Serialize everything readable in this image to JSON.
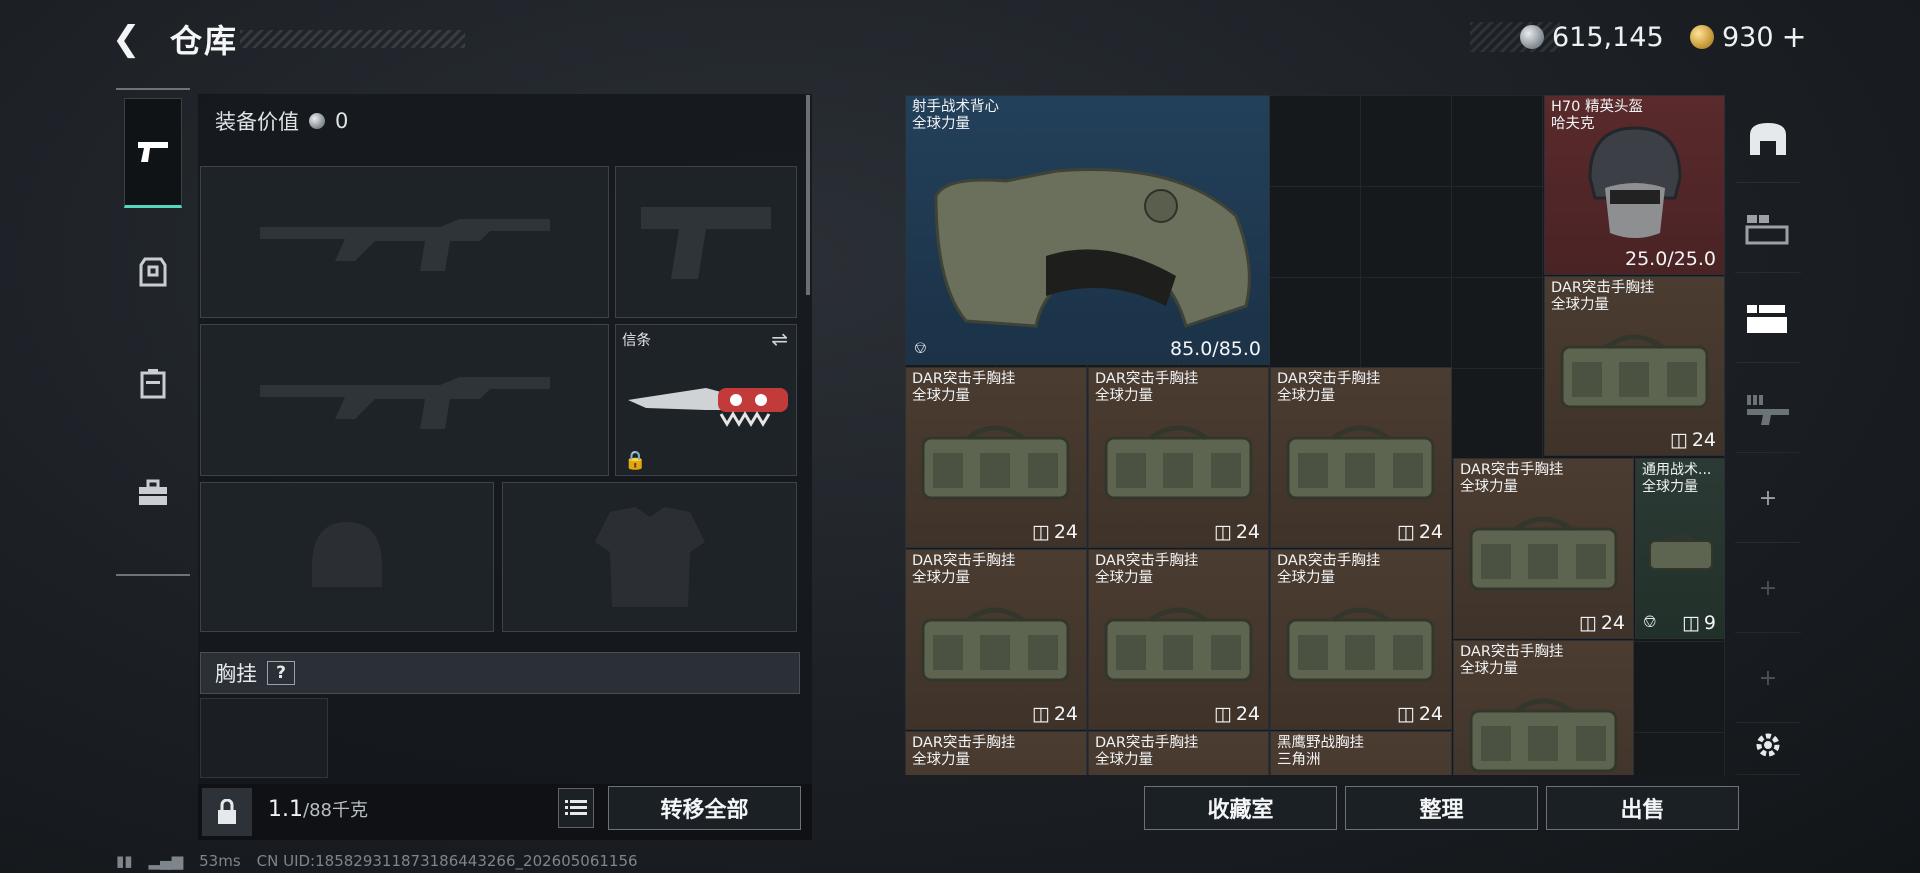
{
  "header": {
    "back_icon": "back-arrow-icon",
    "title": "仓库",
    "silver_amount": "615,145",
    "gold_amount": "930",
    "gold_plus": "+"
  },
  "left_tabs": [
    {
      "icon": "pistol-icon",
      "active": true
    },
    {
      "icon": "armor-icon",
      "active": false
    },
    {
      "icon": "backpack-icon",
      "active": false
    },
    {
      "icon": "toolbox-icon",
      "active": false
    }
  ],
  "equipment": {
    "value_label": "装备价值",
    "value": "0",
    "melee_label": "信条",
    "chest_rig_label": "胸挂",
    "chest_rig_help": "?"
  },
  "weight": {
    "current": "1.1",
    "max": "/88千克"
  },
  "buttons": {
    "transfer_all": "转移全部",
    "collection_room": "收藏室",
    "organize": "整理",
    "sell": "出售"
  },
  "grid_items": {
    "vest": {
      "name": "射手战术背心",
      "sub": "全球力量",
      "durability": "85.0/85.0"
    },
    "helmet": {
      "name": "H70 精英头盔",
      "sub": "哈夫克",
      "durability": "25.0/25.0"
    },
    "rig_right_top": {
      "name": "DAR突击手胸挂",
      "sub": "全球力量",
      "qty": "24"
    },
    "row1": [
      {
        "name": "DAR突击手胸挂",
        "sub": "全球力量",
        "qty": "24"
      },
      {
        "name": "DAR突击手胸挂",
        "sub": "全球力量",
        "qty": "24"
      },
      {
        "name": "DAR突击手胸挂",
        "sub": "全球力量",
        "qty": "24"
      }
    ],
    "rig_mid": {
      "name": "DAR突击手胸挂",
      "sub": "全球力量",
      "qty": "24"
    },
    "general": {
      "name": "通用战术...",
      "sub": "全球力量",
      "qty": "9"
    },
    "row2": [
      {
        "name": "DAR突击手胸挂",
        "sub": "全球力量",
        "qty": "24"
      },
      {
        "name": "DAR突击手胸挂",
        "sub": "全球力量",
        "qty": "24"
      },
      {
        "name": "DAR突击手胸挂",
        "sub": "全球力量",
        "qty": "24"
      }
    ],
    "rig_low": {
      "name": "DAR突击手胸挂",
      "sub": "全球力量"
    },
    "row3": [
      {
        "name": "DAR突击手胸挂",
        "sub": "全球力量"
      },
      {
        "name": "DAR突击手胸挂",
        "sub": "全球力量"
      },
      {
        "name": "黑鹰野战胸挂",
        "sub": "三角洲"
      }
    ]
  },
  "right_tabs": [
    {
      "icon": "vault-icon"
    },
    {
      "icon": "rifle-case-icon"
    },
    {
      "icon": "weapon-case-icon"
    },
    {
      "icon": "gun-rack-icon"
    },
    {
      "icon": "plus-icon",
      "label": "+"
    },
    {
      "icon": "plus-icon",
      "label": "+"
    },
    {
      "icon": "plus-icon",
      "label": "+"
    }
  ],
  "status": {
    "ping": "53ms",
    "uid": "CN UID:18582931187318644326​6_202605061156"
  },
  "colors": {
    "accent_teal": "#58d6c4",
    "tile_brown": "#4b3c31",
    "tile_blue": "#23405a",
    "tile_red": "#5a2a2c"
  }
}
